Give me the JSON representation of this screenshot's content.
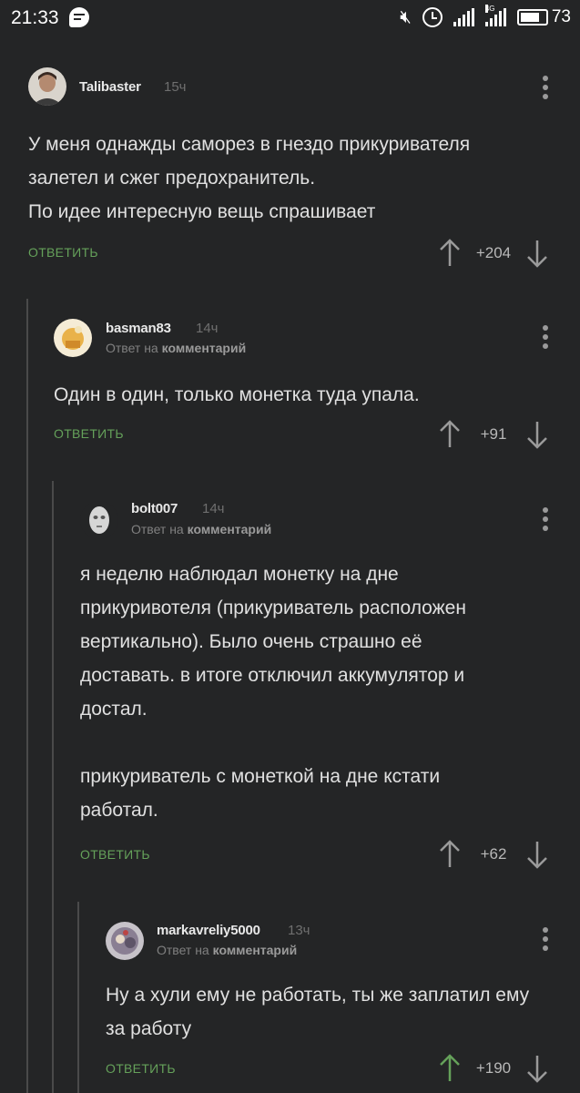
{
  "status_bar": {
    "time": "21:33",
    "network": "4G",
    "battery": "73",
    "battery_level": 0.73
  },
  "comments": [
    {
      "username": "Talibaster",
      "time": "15ч",
      "reply_prefix": "",
      "reply_target": "",
      "text": "У меня однажды саморез в гнездо прикуривателя залетел и сжег предохранитель.\nПо идее интересную вещь спрашивает",
      "reply_label": "ОТВЕТИТЬ",
      "score": "+204",
      "upvoted": false
    },
    {
      "username": "basman83",
      "time": "14ч",
      "reply_prefix": "Ответ на",
      "reply_target": "комментарий",
      "text": "Один в один, только монетка туда упала.",
      "reply_label": "ОТВЕТИТЬ",
      "score": "+91",
      "upvoted": false
    },
    {
      "username": "bolt007",
      "time": "14ч",
      "reply_prefix": "Ответ на",
      "reply_target": "комментарий",
      "text": "я неделю наблюдал монетку на дне прикуривотеля (прикуриватель расположен вертикально). Было очень страшно её доставать. в итоге отключил аккумулятор и достал.\n\nприкуриватель с монеткой на дне кстати работал.",
      "reply_label": "ОТВЕТИТЬ",
      "score": "+62",
      "upvoted": false
    },
    {
      "username": "markavreliy5000",
      "time": "13ч",
      "reply_prefix": "Ответ на",
      "reply_target": "комментарий",
      "text": "Ну а хули ему не работать, ты же заплатил ему за работу",
      "reply_label": "ОТВЕТИТЬ",
      "score": "+190",
      "upvoted": true
    }
  ],
  "colors": {
    "background": "#242526",
    "accent_green": "#65a15a",
    "thread_line": "#4a4a4a",
    "muted_text": "#808080"
  },
  "icons": [
    "chat-icon",
    "mute-icon",
    "alarm-icon",
    "signal-icon",
    "battery-icon",
    "more-vert-icon",
    "arrow-up-icon",
    "arrow-down-icon"
  ]
}
